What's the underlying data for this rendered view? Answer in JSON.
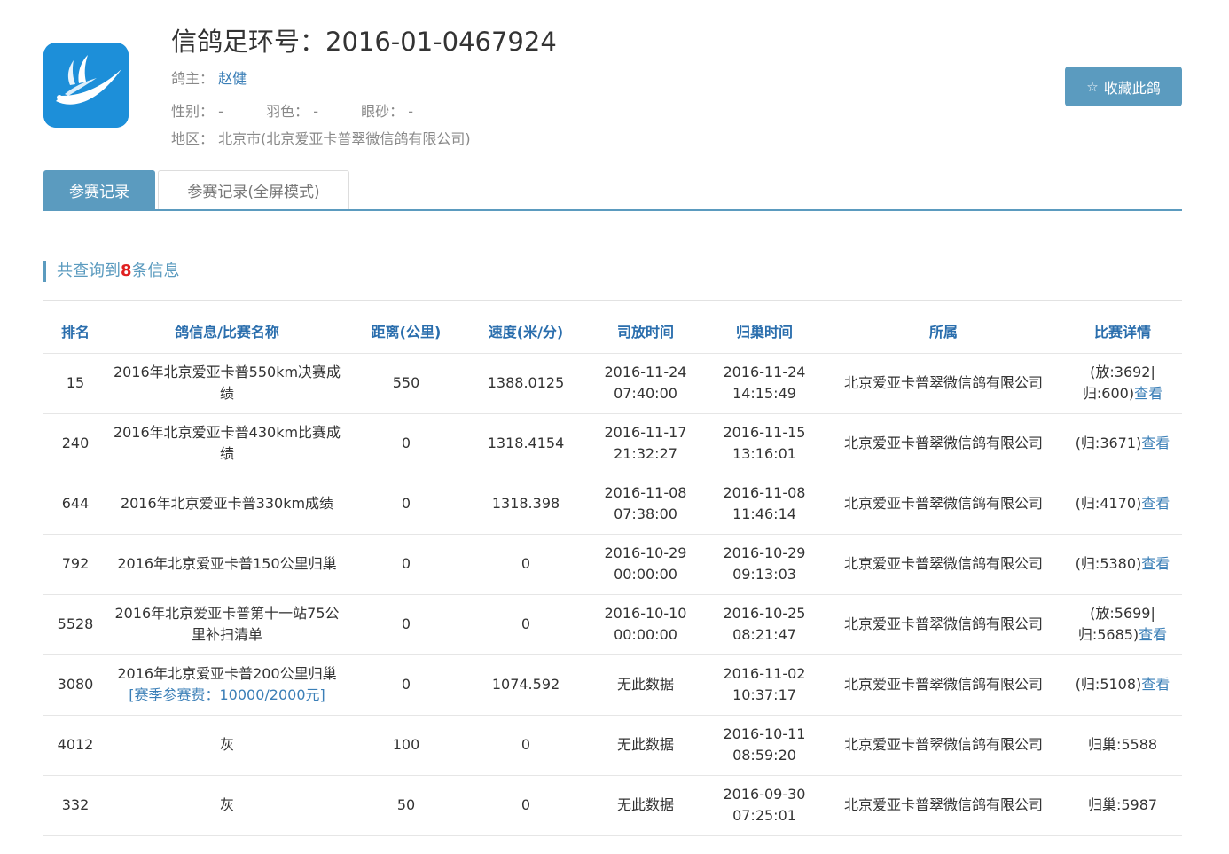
{
  "header": {
    "title": "信鸽足环号：2016-01-0467924",
    "owner_label": "鸽主：",
    "owner_name": "赵健",
    "gender_label": "性别：",
    "gender_value": "-",
    "feather_label": "羽色：",
    "feather_value": "-",
    "eye_label": "眼砂：",
    "eye_value": "-",
    "region_label": "地区：",
    "region_value": "北京市(北京爱亚卡普翠微信鸽有限公司)",
    "favorite_button": "收藏此鸽",
    "logo_icon": "pigeon-logo-icon",
    "accent_color": "#5b9bbf"
  },
  "tabs": [
    {
      "label": "参赛记录",
      "active": true
    },
    {
      "label": "参赛记录(全屏模式)",
      "active": false
    }
  ],
  "summary": {
    "prefix": "共查询到",
    "count": "8",
    "suffix": "条信息"
  },
  "table": {
    "columns": [
      "排名",
      "鸽信息/比赛名称",
      "距离(公里)",
      "速度(米/分)",
      "司放时间",
      "归巢时间",
      "所属",
      "比赛详情"
    ],
    "rows": [
      {
        "rank": "15",
        "name": "2016年北京爱亚卡普550km决赛成绩",
        "fee": "",
        "distance": "550",
        "speed": "1388.0125",
        "release": "2016-11-24 07:40:00",
        "arrival": "2016-11-24 14:15:49",
        "org": "北京爱亚卡普翠微信鸽有限公司",
        "detail": "(放:3692|归:600)",
        "detail_link": "查看"
      },
      {
        "rank": "240",
        "name": "2016年北京爱亚卡普430km比赛成绩",
        "fee": "",
        "distance": "0",
        "speed": "1318.4154",
        "release": "2016-11-17 21:32:27",
        "arrival": "2016-11-15 13:16:01",
        "org": "北京爱亚卡普翠微信鸽有限公司",
        "detail": "(归:3671)",
        "detail_link": "查看"
      },
      {
        "rank": "644",
        "name": "2016年北京爱亚卡普330km成绩",
        "fee": "",
        "distance": "0",
        "speed": "1318.398",
        "release": "2016-11-08 07:38:00",
        "arrival": "2016-11-08 11:46:14",
        "org": "北京爱亚卡普翠微信鸽有限公司",
        "detail": "(归:4170)",
        "detail_link": "查看"
      },
      {
        "rank": "792",
        "name": "2016年北京爱亚卡普150公里归巢",
        "fee": "",
        "distance": "0",
        "speed": "0",
        "release": "2016-10-29 00:00:00",
        "arrival": "2016-10-29 09:13:03",
        "org": "北京爱亚卡普翠微信鸽有限公司",
        "detail": "(归:5380)",
        "detail_link": "查看"
      },
      {
        "rank": "5528",
        "name": "2016年北京爱亚卡普第十一站75公里补扫清单",
        "fee": "",
        "distance": "0",
        "speed": "0",
        "release": "2016-10-10 00:00:00",
        "arrival": "2016-10-25 08:21:47",
        "org": "北京爱亚卡普翠微信鸽有限公司",
        "detail": "(放:5699|归:5685)",
        "detail_link": "查看"
      },
      {
        "rank": "3080",
        "name": "2016年北京爱亚卡普200公里归巢",
        "fee": "[赛季参赛费：10000/2000元]",
        "distance": "0",
        "speed": "1074.592",
        "release": "无此数据",
        "arrival": "2016-11-02 10:37:17",
        "org": "北京爱亚卡普翠微信鸽有限公司",
        "detail": "(归:5108)",
        "detail_link": "查看"
      },
      {
        "rank": "4012",
        "name": "灰",
        "fee": "",
        "distance": "100",
        "speed": "0",
        "release": "无此数据",
        "arrival": "2016-10-11 08:59:20",
        "org": "北京爱亚卡普翠微信鸽有限公司",
        "detail": "归巢:5588",
        "detail_link": ""
      },
      {
        "rank": "332",
        "name": "灰",
        "fee": "",
        "distance": "50",
        "speed": "0",
        "release": "无此数据",
        "arrival": "2016-09-30 07:25:01",
        "org": "北京爱亚卡普翠微信鸽有限公司",
        "detail": "归巢:5987",
        "detail_link": ""
      }
    ]
  }
}
